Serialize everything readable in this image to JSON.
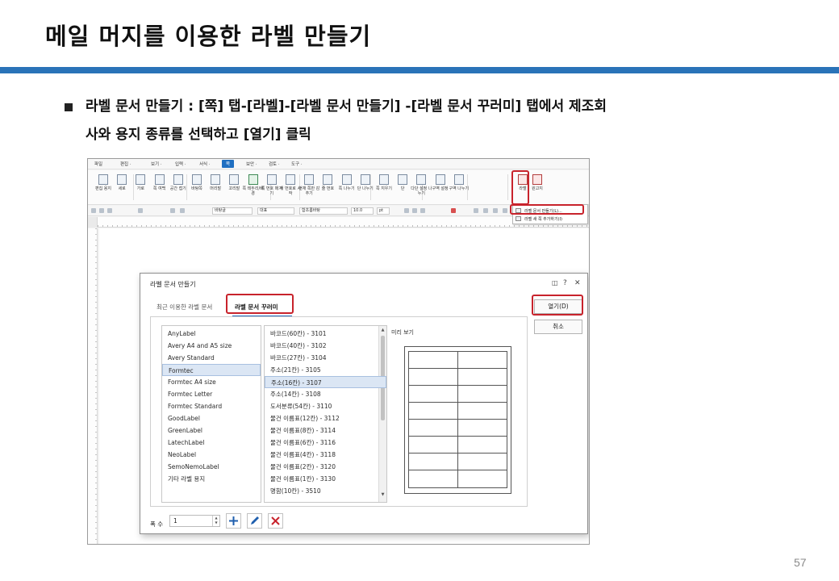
{
  "slide": {
    "title": "메일 머지를 이용한 라벨 만들기",
    "bullet_line1": "라벨 문서 만들기 : [쪽] 탭-[라벨]-[라벨 문서 만들기] -[라벨 문서 꾸러미] 탭에서 제조회",
    "bullet_line2": "사와 용지 종류를 선택하고 [열기] 클릭",
    "page_number": "57",
    "accent_color": "#2a73b8",
    "highlight_color": "#c8232c"
  },
  "app": {
    "menu": [
      {
        "label": "파일"
      },
      {
        "label": "편집 ·"
      },
      {
        "label": "보기 ·"
      },
      {
        "label": "입력 ·"
      },
      {
        "label": "서식 ·"
      },
      {
        "label": "쪽"
      },
      {
        "label": "보안 ·"
      },
      {
        "label": "검토 ·"
      },
      {
        "label": "도구 ·"
      }
    ],
    "ribbon": [
      {
        "label": "편집 용지",
        "icon": "page-setup-icon"
      },
      {
        "label": "세로",
        "icon": "portrait-icon"
      },
      {
        "label": "가로",
        "icon": "landscape-icon"
      },
      {
        "label": "쪽 여백",
        "icon": "margin-icon"
      },
      {
        "label": "공간 접기",
        "icon": "fold-icon"
      },
      {
        "label": "바탕쪽",
        "icon": "master-page-icon"
      },
      {
        "label": "머리말",
        "icon": "header-icon"
      },
      {
        "label": "꼬리말",
        "icon": "footer-icon"
      },
      {
        "label": "쪽 테두리/배경",
        "icon": "page-border-icon"
      },
      {
        "label": "쪽 번호 매기기",
        "icon": "page-number-icon"
      },
      {
        "label": "새 번호로 시작",
        "icon": "new-number-icon"
      },
      {
        "label": "현재 쪽만 감추기",
        "icon": "hide-icon"
      },
      {
        "label": "줄 번호",
        "icon": "line-number-icon"
      },
      {
        "label": "쪽 나누기",
        "icon": "page-break-icon"
      },
      {
        "label": "단 나누기",
        "icon": "column-break-icon"
      },
      {
        "label": "쪽 지우기",
        "icon": "delete-page-icon"
      },
      {
        "label": "단",
        "icon": "columns-icon"
      },
      {
        "label": "다단 설정 나누기",
        "icon": "multi-column-icon"
      },
      {
        "label": "구역 설정",
        "icon": "section-icon"
      },
      {
        "label": "구역 나누기",
        "icon": "section-break-icon"
      },
      {
        "label": "라벨",
        "icon": "label-icon"
      },
      {
        "label": "원고지",
        "icon": "manuscript-icon"
      }
    ],
    "toolbar": {
      "style": "바탕글",
      "language": "대표",
      "font": "함초롬바탕",
      "size": "10.0",
      "unit": "pt"
    },
    "label_menu": {
      "create": "라벨 문서 만들기(L)...",
      "new_field": "라벨 새 쪽 추가하기(I)"
    }
  },
  "dialog": {
    "title": "라벨 문서 만들기",
    "tabs": {
      "recent": "최근 이용한 라벨 문서",
      "catalog": "라벨 문서 꾸러미"
    },
    "manufacturers": [
      {
        "name": "AnyLabel"
      },
      {
        "name": "Avery A4 and A5 size"
      },
      {
        "name": "Avery Standard"
      },
      {
        "name": "Formtec",
        "selected": true
      },
      {
        "name": "Formtec A4 size"
      },
      {
        "name": "Formtec Letter"
      },
      {
        "name": "Formtec Standard"
      },
      {
        "name": "GoodLabel"
      },
      {
        "name": "GreenLabel"
      },
      {
        "name": "LatechLabel"
      },
      {
        "name": "NeoLabel"
      },
      {
        "name": "SemoNemoLabel"
      },
      {
        "name": "기타 라벨 용지"
      }
    ],
    "papers": [
      {
        "name": "바코드(60칸) - 3101"
      },
      {
        "name": "바코드(40칸) - 3102"
      },
      {
        "name": "바코드(27칸) - 3104"
      },
      {
        "name": "주소(21칸) - 3105"
      },
      {
        "name": "주소(16칸) - 3107",
        "selected": true
      },
      {
        "name": "주소(14칸) - 3108"
      },
      {
        "name": "도서분류(54칸) - 3110"
      },
      {
        "name": "물건 이름표(12칸) - 3112"
      },
      {
        "name": "물건 이름표(8칸) - 3114"
      },
      {
        "name": "물건 이름표(6칸) - 3116"
      },
      {
        "name": "물건 이름표(4칸) - 3118"
      },
      {
        "name": "물건 이름표(2칸) - 3120"
      },
      {
        "name": "물건 이름표(1칸) - 3130"
      },
      {
        "name": "명함(10칸) - 3510"
      }
    ],
    "preview_label": "미리 보기",
    "preview_grid": {
      "columns": 2,
      "rows": 8
    },
    "open_button": "열기(D)",
    "cancel_button": "취소",
    "count_label": "폭 수",
    "count_value": "1"
  }
}
